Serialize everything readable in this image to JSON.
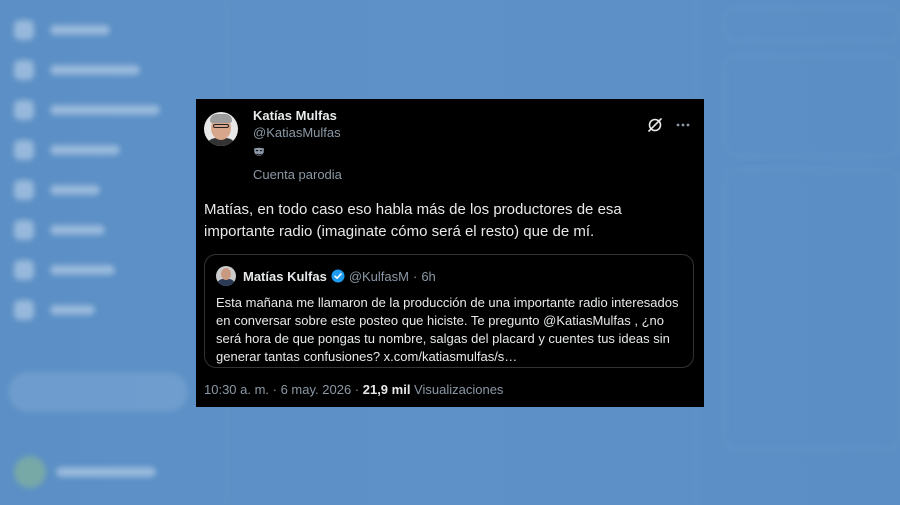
{
  "tweet": {
    "display_name": "Katías Mulfas",
    "handle": "@KatiasMulfas",
    "parody_label": "Cuenta parodia",
    "text": "Matías, en todo caso eso habla más de los productores de esa importante radio (imaginate cómo será el resto) que de mí.",
    "quote": {
      "display_name": "Matías Kulfas",
      "handle": "@KulfasM",
      "separator": "·",
      "time": "6h",
      "text": "Esta mañana me llamaron de la producción de una importante radio interesados en conversar sobre este posteo que hiciste. Te pregunto @KatiasMulfas , ¿no será hora de que pongas tu nombre, salgas del placard y cuentes tus ideas sin generar tantas confusiones? x.com/katiasmulfas/s…"
    },
    "timestamp": "10:30 a. m. · 6 may. 2026 · ",
    "views_count": "21,9 mil",
    "views_label": " Visualizaciones"
  },
  "icons": {
    "grok": "grok-icon",
    "more": "more-icon",
    "parody": "parody-mask-icon",
    "verified": "verified-badge-icon"
  },
  "colors": {
    "background": "#5a8ec4",
    "card": "#000000",
    "text": "#e7e9ea",
    "muted": "#8b98a5",
    "verified": "#1d9bf0"
  }
}
